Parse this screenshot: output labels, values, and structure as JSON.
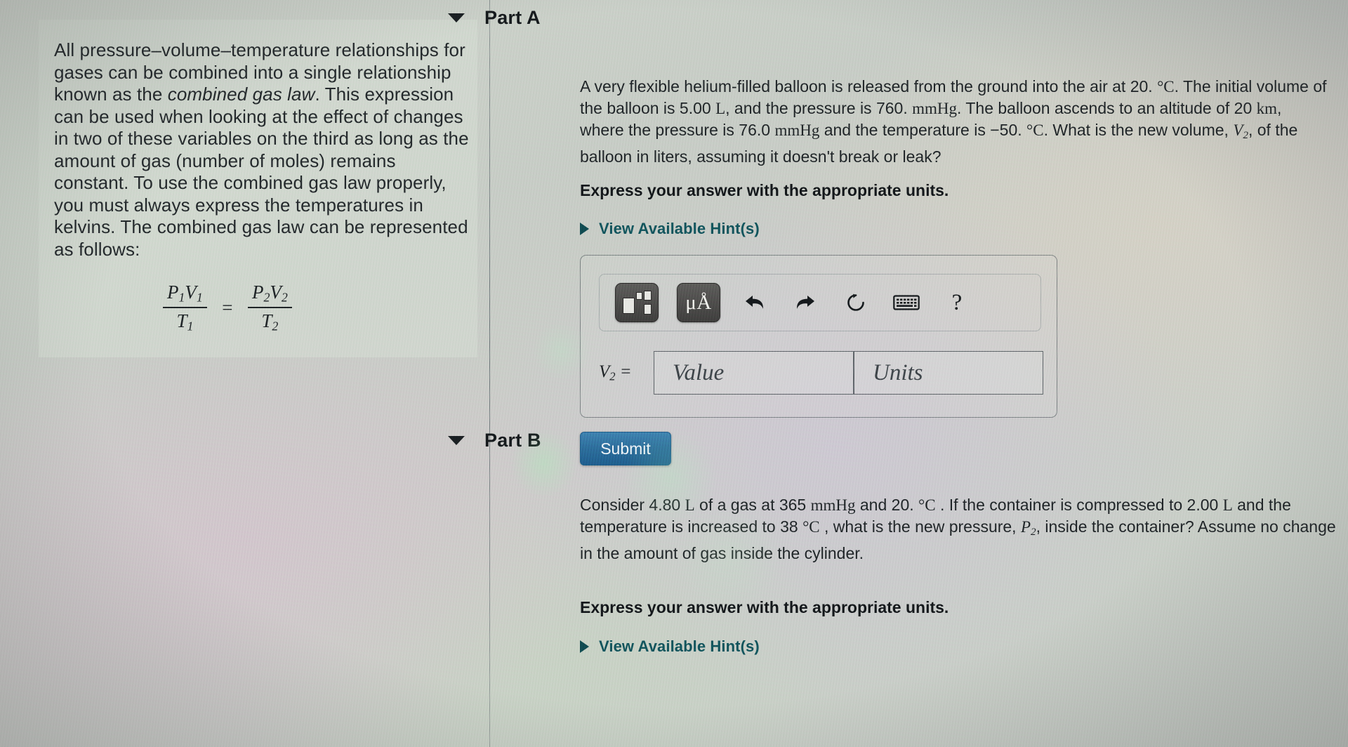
{
  "sidebar": {
    "intro_paragraph": "All pressure–volume–temperature relationships for gases can be combined into a single relationship known as the ",
    "intro_emphasis": "combined gas law",
    "intro_paragraph_2": ". This expression can be used when looking at the effect of changes in two of these variables on the third as long as the amount of gas (number of moles) remains constant. To use the combined gas law properly, you must always express the temperatures in kelvins. The combined gas law can be represented as follows:",
    "formula": {
      "left_numerator": "P₁V₁",
      "left_denominator": "T₁",
      "equals": "=",
      "right_numerator": "P₂V₂",
      "right_denominator": "T₂",
      "p1": "P",
      "p1_sub": "1",
      "v1": "V",
      "v1_sub": "1",
      "t1": "T",
      "t1_sub": "1",
      "p2": "P",
      "p2_sub": "2",
      "v2": "V",
      "v2_sub": "2",
      "t2": "T",
      "t2_sub": "2"
    }
  },
  "part_a": {
    "title": "Part A",
    "caret_icon": "caret-down-icon",
    "question_segments": {
      "s1": "A very flexible helium-filled balloon is released from the ground into the air at 20. ",
      "degC_1": "°C",
      "s2": ". The initial volume of the balloon is 5.00 ",
      "unit_L_1": "L",
      "s3": ", and the pressure is 760. ",
      "unit_mmHg_1": "mmHg",
      "s4": ". The balloon ascends to an altitude of 20 ",
      "unit_km": "km",
      "s5": ", where the pressure is 76.0 ",
      "unit_mmHg_2": "mmHg",
      "s6": " and the temperature is −50. ",
      "degC_2": "°C",
      "s7": ". What is the new volume, ",
      "var_V2": "V",
      "var_V2_sub": "2",
      "s8": ", of the balloon in liters, assuming it doesn't break or leak?"
    },
    "express_instruction": "Express your answer with the appropriate units.",
    "hint_label": "View Available Hint(s)",
    "hint_caret_icon": "caret-right-icon",
    "answer": {
      "toolbar": {
        "math_template_label": "math-template",
        "units_label": "μÅ",
        "undo_label": "undo",
        "redo_label": "redo",
        "reset_label": "reset",
        "keyboard_label": "keyboard",
        "help_label": "?"
      },
      "variable_label": "V",
      "variable_sub": "2",
      "variable_equals": "=",
      "value_placeholder": "Value",
      "units_placeholder": "Units",
      "value_current": "",
      "units_current": ""
    },
    "submit_label": "Submit"
  },
  "part_b": {
    "title": "Part B",
    "caret_icon": "caret-down-icon",
    "question_segments": {
      "s1": "Consider 4.80 ",
      "unit_L_1": "L",
      "s2": " of a gas at 365 ",
      "unit_mmHg": "mmHg",
      "s3": " and 20. ",
      "degC_1": "°C",
      "s4": " . If the container is compressed to 2.00 ",
      "unit_L_2": "L",
      "s5": " and the temperature is increased to 38 ",
      "degC_2": "°C",
      "s6": " , what is the new pressure, ",
      "var_P2": "P",
      "var_P2_sub": "2",
      "s7": ", inside the container? Assume no change in the amount of gas inside the cylinder."
    },
    "express_instruction": "Express your answer with the appropriate units.",
    "hint_label": "View Available Hint(s)",
    "hint_caret_icon": "caret-right-icon"
  },
  "colors": {
    "link": "#11525a",
    "submit_button": "#2c6b99",
    "text": "#1e2326",
    "panel_background": "#c9cec6"
  }
}
